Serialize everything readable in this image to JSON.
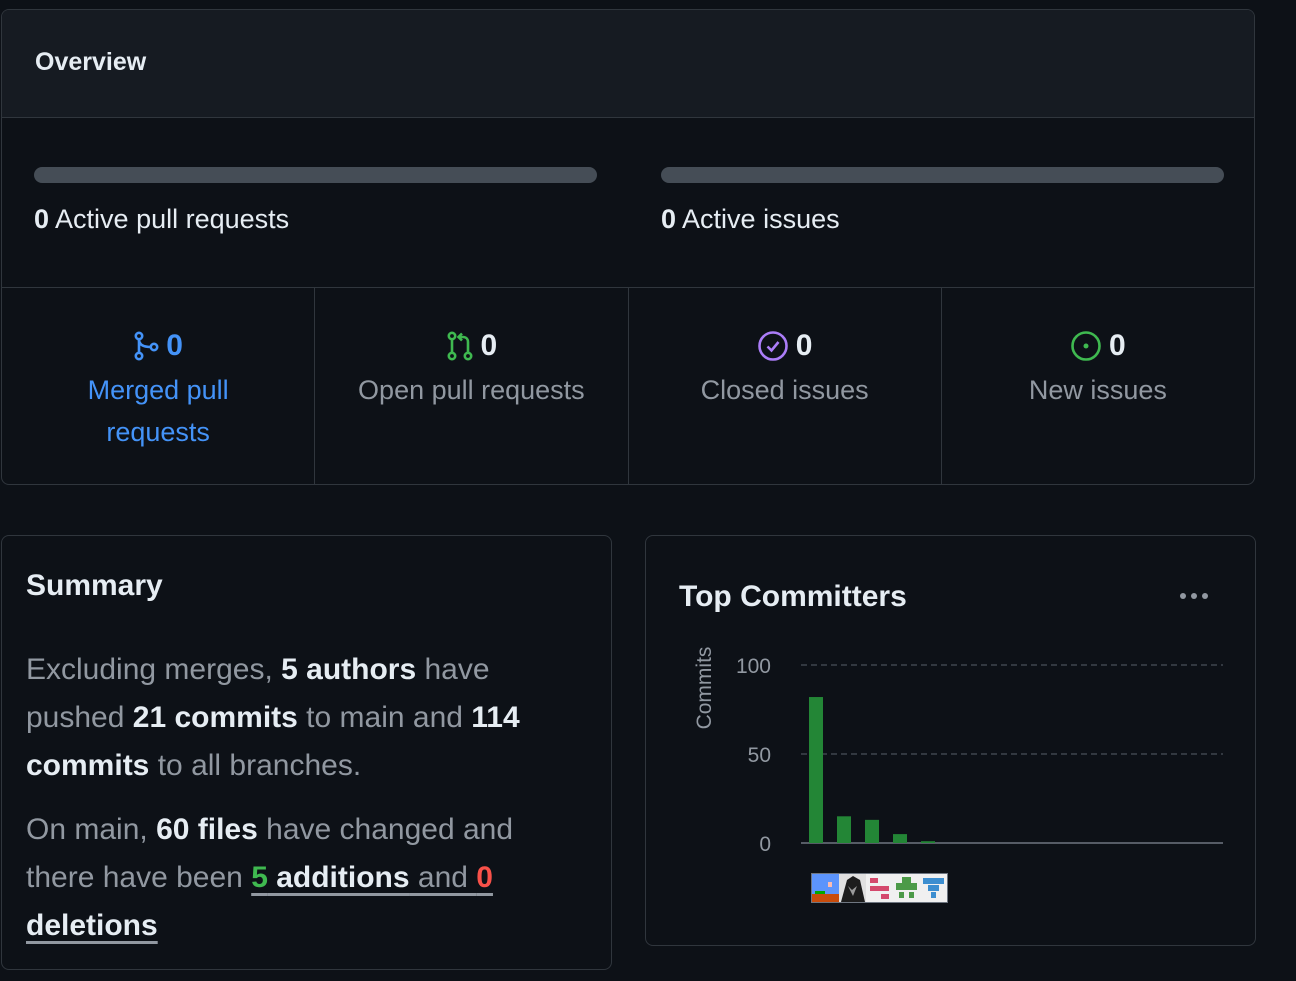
{
  "overview": {
    "title": "Overview",
    "pull_requests": {
      "count": "0",
      "label": "Active pull requests",
      "merged_fraction": 0
    },
    "issues": {
      "count": "0",
      "label": "Active issues",
      "closed_fraction": 0
    },
    "stats": [
      {
        "count": "0",
        "label_lines": [
          "Merged pull",
          "requests"
        ],
        "icon": "git-merge-icon",
        "color": "#4493f8"
      },
      {
        "count": "0",
        "label_lines": [
          "Open pull requests"
        ],
        "icon": "git-pull-request-icon",
        "color": "#3fb950"
      },
      {
        "count": "0",
        "label_lines": [
          "Closed issues"
        ],
        "icon": "issue-closed-icon",
        "color": "#ab7df8"
      },
      {
        "count": "0",
        "label_lines": [
          "New issues"
        ],
        "icon": "issue-opened-icon",
        "color": "#3fb950"
      }
    ]
  },
  "summary": {
    "title": "Summary",
    "p1": {
      "t1": "Excluding merges, ",
      "authors": "5 authors",
      "t2": " have pushed ",
      "commits_main": "21 commits",
      "t3": " to main and ",
      "commits_all": "114 commits",
      "t4": " to all branches."
    },
    "p2": {
      "t1": "On main, ",
      "files": "60 files",
      "t2": " have changed and there have been ",
      "additions_num": "5",
      "additions_word": " additions",
      "t3": " and ",
      "deletions_num": "0",
      "deletions_word": "deletions"
    }
  },
  "top_committers": {
    "title": "Top Committers",
    "menu_icon": "kebab-horizontal-icon",
    "avatars": [
      "avatar-1",
      "avatar-2",
      "avatar-3",
      "avatar-4",
      "avatar-5"
    ]
  },
  "chart_data": {
    "type": "bar",
    "title": "",
    "ylabel": "Commits",
    "xlabel": "",
    "ylim": [
      0,
      100
    ],
    "yticks": [
      "0",
      "50",
      "100"
    ],
    "grid": true,
    "values": [
      82,
      15,
      13,
      5,
      1
    ],
    "color": "#238636"
  }
}
